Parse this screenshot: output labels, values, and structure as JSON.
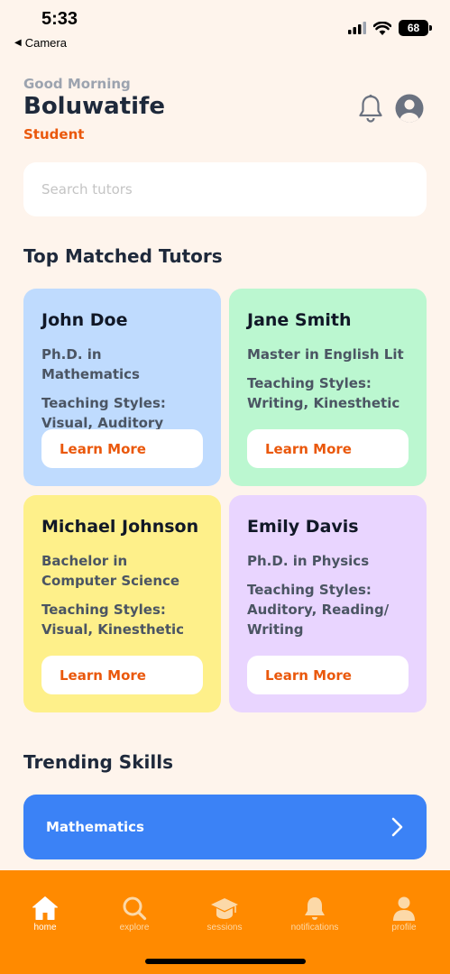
{
  "status_bar": {
    "time": "5:33",
    "back_label": "Camera",
    "battery": "68"
  },
  "header": {
    "greeting": "Good Morning",
    "user_name": "Boluwatife",
    "role": "Student"
  },
  "search": {
    "placeholder": "Search tutors"
  },
  "sections": {
    "top_tutors": "Top Matched Tutors",
    "trending": "Trending Skills"
  },
  "tutors": [
    {
      "name": "John Doe",
      "degree": "Ph.D. in Mathematics",
      "styles": "Teaching Styles: Visual, Auditory",
      "button": "Learn More",
      "color": "#bfdbfe"
    },
    {
      "name": "Jane Smith",
      "degree": "Master in English Lit",
      "styles": "Teaching Styles: Writing, Kinesthetic",
      "button": "Learn More",
      "color": "#bbf7d0"
    },
    {
      "name": "Michael Johnson",
      "degree": "Bachelor in Computer Science",
      "styles": "Teaching Styles: Visual, Kinesthetic",
      "button": "Learn More",
      "color": "#fef08a"
    },
    {
      "name": "Emily Davis",
      "degree": "Ph.D. in Physics",
      "styles": "Teaching Styles: Auditory, Reading/ Writing",
      "button": "Learn More",
      "color": "#e9d5ff"
    }
  ],
  "trending_skills": [
    {
      "label": "Mathematics",
      "icon": "chevron-right-icon"
    }
  ],
  "bottom_nav": [
    {
      "label": "home",
      "icon": "home-icon",
      "active": true
    },
    {
      "label": "explore",
      "icon": "search-icon",
      "active": false
    },
    {
      "label": "sessions",
      "icon": "graduation-cap-icon",
      "active": false
    },
    {
      "label": "notifications",
      "icon": "bell-icon",
      "active": false
    },
    {
      "label": "profile",
      "icon": "person-icon",
      "active": false
    }
  ],
  "colors": {
    "background": "#fef4ec",
    "accent": "#ea580c",
    "nav": "#ff8a00",
    "skill_bar": "#3b82f6"
  }
}
